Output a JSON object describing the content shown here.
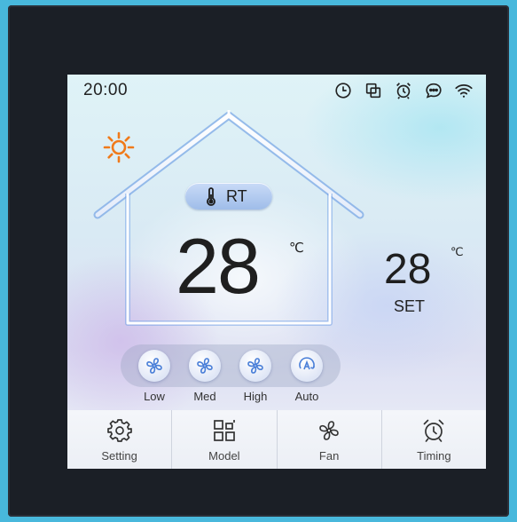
{
  "status_bar": {
    "time": "20:00",
    "icons": [
      "clock-icon",
      "copy-icon",
      "alarm-icon",
      "chat-icon",
      "wifi-icon"
    ]
  },
  "mode": {
    "icon": "sun-icon",
    "color": "#f07a1a"
  },
  "room": {
    "label": "RT",
    "temperature": "28",
    "unit": "℃"
  },
  "set": {
    "temperature": "28",
    "unit": "℃",
    "label": "SET"
  },
  "fan_speeds": [
    {
      "label": "Low",
      "icon": "fan-icon"
    },
    {
      "label": "Med",
      "icon": "fan-icon"
    },
    {
      "label": "High",
      "icon": "fan-icon"
    },
    {
      "label": "Auto",
      "icon": "auto-icon"
    }
  ],
  "bottom_tabs": [
    {
      "label": "Setting",
      "icon": "gear-icon"
    },
    {
      "label": "Model",
      "icon": "grid-icon"
    },
    {
      "label": "Fan",
      "icon": "fan-icon"
    },
    {
      "label": "Timing",
      "icon": "alarm-icon"
    }
  ],
  "colors": {
    "accent": "#4a7fd8",
    "bezel": "#1b1f26",
    "background": "#48b8dc"
  }
}
